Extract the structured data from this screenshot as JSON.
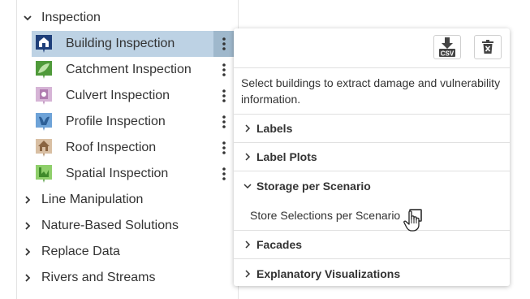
{
  "tree": {
    "group_open": {
      "label": "Inspection",
      "icon": "chevron-down-icon"
    },
    "items": [
      {
        "label": "Building Inspection",
        "icon": "building-inspection-icon",
        "selected": true
      },
      {
        "label": "Catchment Inspection",
        "icon": "catchment-inspection-icon"
      },
      {
        "label": "Culvert Inspection",
        "icon": "culvert-inspection-icon"
      },
      {
        "label": "Profile Inspection",
        "icon": "profile-inspection-icon"
      },
      {
        "label": "Roof Inspection",
        "icon": "roof-inspection-icon"
      },
      {
        "label": "Spatial Inspection",
        "icon": "spatial-inspection-icon"
      }
    ],
    "groups_closed": [
      {
        "label": "Line Manipulation"
      },
      {
        "label": "Nature-Based Solutions"
      },
      {
        "label": "Replace Data"
      },
      {
        "label": "Rivers and Streams"
      }
    ]
  },
  "popup": {
    "csv_button_label": "CSV",
    "description": "Select buildings to extract damage and vulnerability information.",
    "sections": [
      {
        "label": "Labels",
        "open": false
      },
      {
        "label": "Label Plots",
        "open": false
      },
      {
        "label": "Storage per Scenario",
        "open": true
      },
      {
        "label": "Facades",
        "open": false
      },
      {
        "label": "Explanatory Visualizations",
        "open": false
      }
    ],
    "storage_option": {
      "label": "Store Selections per Scenario",
      "checked": false
    }
  },
  "colors": {
    "selected_row": "#bdd2e4",
    "selected_dots": "#9fb8cc",
    "building_icon": "#1f3f7a",
    "catchment_icon": "#4f9a3a",
    "culvert_icon": "#b07cb0",
    "profile_icon": "#4a84c4",
    "roof_icon": "#a9835d",
    "spatial_icon": "#4f9a3a"
  }
}
